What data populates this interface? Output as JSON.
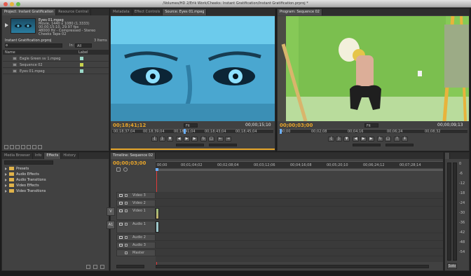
{
  "window": {
    "title": "/Volumes/HD 2/Erik Work/Cheeks: Instant Gratification/Instant Gratification.prproj *"
  },
  "project": {
    "tabs": [
      "Project: Instant Gratification",
      "Resource Central"
    ],
    "clip_name": "Eyes 01.mpeg",
    "clip_info": [
      "Movie, 1440 x 1080 (1.3333)",
      "00;00;15;10, 29.97 fps",
      "48000 Hz - Compressed - Stereo",
      "Cheeks Tape 02"
    ],
    "project_file": "Instant Gratification.prproj",
    "item_count": "3 Items",
    "in_label": "In:",
    "in_value": "All",
    "col_name": "Name",
    "col_label": "Label",
    "items": [
      "Eagle Green sv 1.mpeg",
      "Sequence 02",
      "Eyes 01.mpeg"
    ]
  },
  "effects": {
    "tabs": [
      "Media Browser",
      "Info",
      "Effects",
      "History"
    ],
    "folders": [
      "Presets",
      "Audio Effects",
      "Audio Transitions",
      "Video Effects",
      "Video Transitions"
    ]
  },
  "source": {
    "tabs": [
      "Metadata",
      "Effect Controls",
      "Source: Eyes 01.mpeg"
    ],
    "timecode": "00;18;41;12",
    "fit": "Fit",
    "duration": "00;00;15;10",
    "ruler": [
      "00;18;37;04",
      "00;18;39;04",
      "00;18;41;04",
      "00;18;43;04",
      "00;18;45;04"
    ]
  },
  "program": {
    "tabs": [
      "Program: Sequence 02"
    ],
    "timecode": "00;00;03;00",
    "fit": "Fit",
    "duration": "00;00;09;13",
    "ruler": [
      "00;00",
      "00;02;08",
      "00;04;16",
      "00;06;24",
      "00;08;32"
    ]
  },
  "timeline": {
    "tabs": [
      "Timeline: Sequence 02"
    ],
    "timecode": "00;00;03;00",
    "ruler": [
      "00;00",
      "00;01;04;02",
      "00;02;08;04",
      "00;03;12;06",
      "00;04;16;08",
      "00;05;20;10",
      "00;06;24;12",
      "00;07;28;14"
    ],
    "video_tracks": [
      "Video 3",
      "Video 2",
      "Video 1"
    ],
    "audio_tracks": [
      "Audio 1",
      "Audio 2",
      "Audio 3",
      "Master"
    ],
    "v_target": "V",
    "a_target": "A1"
  },
  "audio_meter": {
    "labels": [
      "0",
      "-6",
      "-12",
      "-18",
      "-24",
      "-30",
      "-36",
      "-42",
      "-48",
      "-54"
    ],
    "solo": "Solo"
  }
}
